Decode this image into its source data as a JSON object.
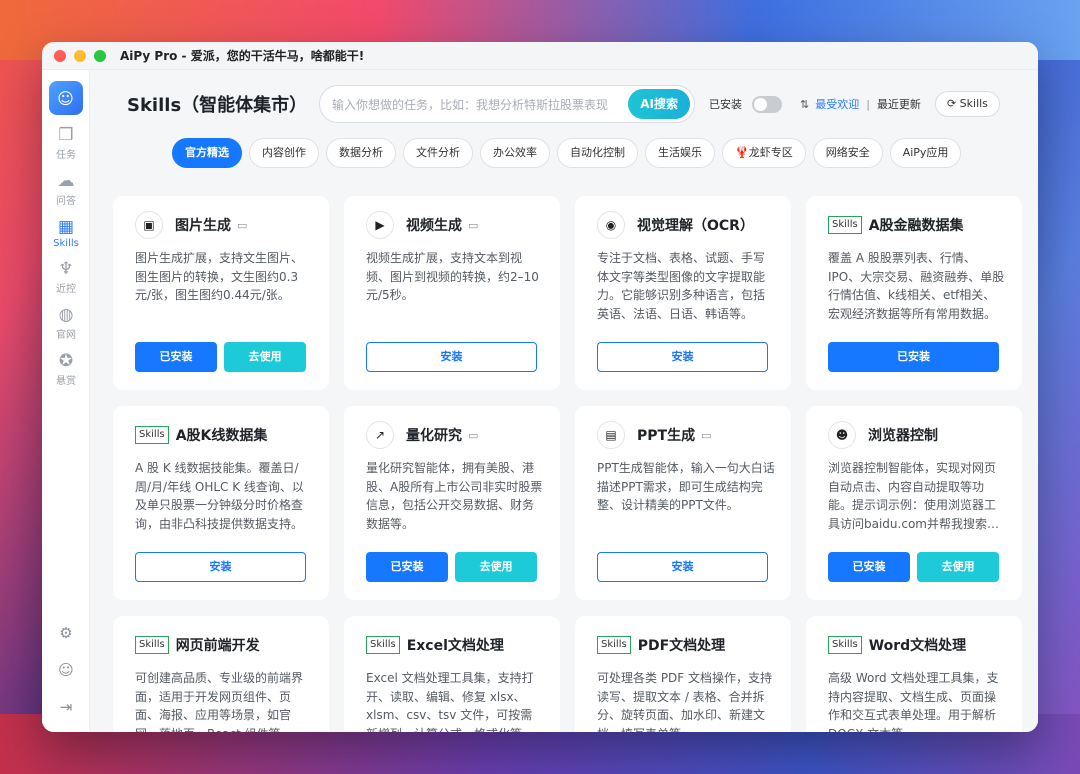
{
  "window": {
    "title": "AiPy Pro - 爱派，您的干活牛马，啥都能干!"
  },
  "sidebar": {
    "logo_icon": "cat-logo-icon",
    "items": [
      {
        "icon": "tasks-icon",
        "label": "任务"
      },
      {
        "icon": "chat-icon",
        "label": "问答"
      },
      {
        "icon": "skills-icon",
        "label": "Skills",
        "active": true
      },
      {
        "icon": "lobster-icon",
        "label": "近控"
      },
      {
        "icon": "globe-icon",
        "label": "官网"
      },
      {
        "icon": "reward-icon",
        "label": "悬赏"
      }
    ],
    "bottom": [
      "gear-icon",
      "user-icon",
      "logout-icon"
    ]
  },
  "header": {
    "title": "Skills（智能体集市）",
    "search_placeholder": "输入你想做的任务，比如：我想分析特斯拉股票表现",
    "search_button": "AI搜索",
    "installed_label": "已安装",
    "sort_popular": "最受欢迎",
    "sort_sep": "|",
    "sort_recent": "最近更新",
    "skills_button": "Skills"
  },
  "tabs": [
    {
      "label": "官方精选",
      "active": true
    },
    {
      "label": "内容创作"
    },
    {
      "label": "数据分析"
    },
    {
      "label": "文件分析"
    },
    {
      "label": "办公效率"
    },
    {
      "label": "自动化控制"
    },
    {
      "label": "生活娱乐"
    },
    {
      "label": "龙虾专区",
      "prefix": "🦞"
    },
    {
      "label": "网络安全"
    },
    {
      "label": "AiPy应用"
    }
  ],
  "cards": [
    {
      "title": "图片生成",
      "icon": "image-icon",
      "doc": true,
      "desc": "图片生成扩展，支持文生图片、图生图片的转换，文生图约0.3元/张，图生图约0.44元/张。",
      "buttons": [
        "已安装",
        "去使用"
      ]
    },
    {
      "title": "视频生成",
      "icon": "video-icon",
      "doc": true,
      "desc": "视频生成扩展，支持文本到视频、图片到视频的转换，约2–10元/5秒。",
      "buttons": [
        "安装"
      ]
    },
    {
      "title": "视觉理解（OCR）",
      "icon": "eye-scan-icon",
      "doc": false,
      "desc": "专注于文档、表格、试题、手写体文字等类型图像的文字提取能力。它能够识别多种语言，包括英语、法语、日语、韩语等。",
      "buttons": [
        "安装"
      ]
    },
    {
      "title": "A股金融数据集",
      "tag": "Skills",
      "desc": "覆盖 A 股股票列表、行情、IPO、大宗交易、融资融券、单股行情估值、k线相关、etf相关、宏观经济数据等所有常用数据。",
      "buttons": [
        "已安装"
      ]
    },
    {
      "title": "A股K线数据集",
      "tag": "Skills",
      "desc": "A 股 K 线数据技能集。覆盖日/周/月/年线 OHLC K 线查询、以及单只股票一分钟级分时价格查询，由非凸科技提供数据支持。",
      "buttons": [
        "安装"
      ]
    },
    {
      "title": "量化研究",
      "icon": "chart-line-icon",
      "doc": true,
      "desc": "量化研究智能体，拥有美股、港股、A股所有上市公司非实时股票信息，包括公开交易数据、财务数据等。",
      "buttons": [
        "已安装",
        "去使用"
      ]
    },
    {
      "title": "PPT生成",
      "icon": "presentation-icon",
      "doc": true,
      "desc": "PPT生成智能体，输入一句大白话描述PPT需求，即可生成结构完整、设计精美的PPT文件。",
      "buttons": [
        "安装"
      ]
    },
    {
      "title": "浏览器控制",
      "icon": "mask-icon",
      "doc": false,
      "desc": "浏览器控制智能体，实现对网页自动点击、内容自动提取等功能。提示词示例：使用浏览器工具访问baidu.com并帮我搜索今天的新闻。",
      "buttons": [
        "已安装",
        "去使用"
      ]
    },
    {
      "title": "网页前端开发",
      "tag": "Skills",
      "desc": "可创建高品质、专业级的前端界面，适用于开发网页组件、页面、海报、应用等场景，如官网、落地页、React 组件等。",
      "buttons": []
    },
    {
      "title": "Excel文档处理",
      "tag": "Skills",
      "desc": "Excel 文档处理工具集，支持打开、读取、编辑、修复 xlsx、xlsm、csv、tsv 文件，可按需新增列、计算公式、格式化等。",
      "buttons": []
    },
    {
      "title": "PDF文档处理",
      "tag": "Skills",
      "desc": "可处理各类 PDF 文档操作，支持读写、提取文本 / 表格、合并拆分、旋转页面、加水印、新建文档、填写表单等。",
      "buttons": []
    },
    {
      "title": "Word文档处理",
      "tag": "Skills",
      "desc": "高级 Word 文档处理工具集，支持内容提取、文档生成、页面操作和交互式表单处理。用于解析 DOCX 文本等。",
      "buttons": []
    }
  ]
}
